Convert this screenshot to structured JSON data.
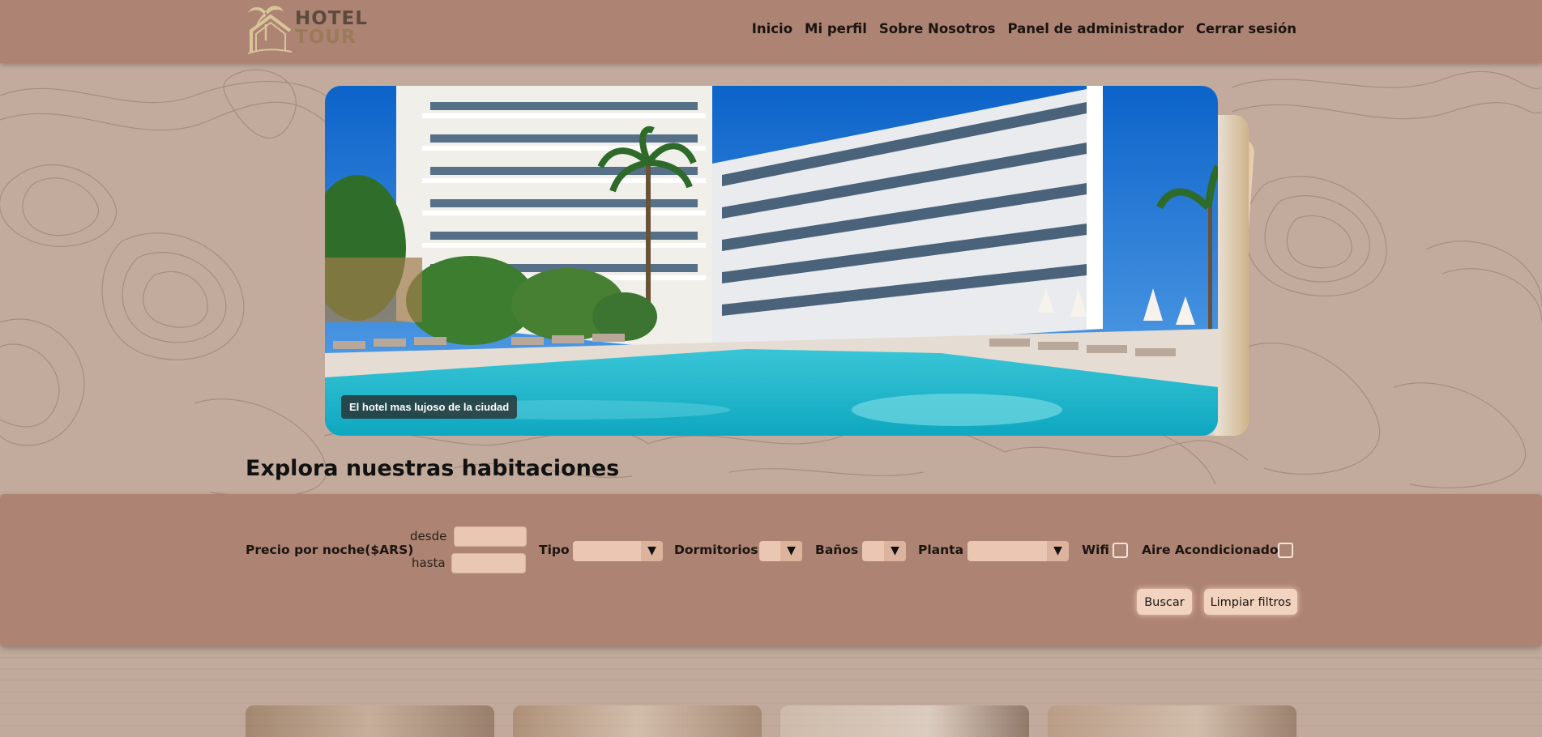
{
  "brand": {
    "logo_line1": "HOTEL",
    "logo_line2": "TOUR"
  },
  "nav": {
    "items": [
      {
        "label": "Inicio"
      },
      {
        "label": "Mi perfil"
      },
      {
        "label": "Sobre Nosotros"
      },
      {
        "label": "Panel de administrador"
      },
      {
        "label": "Cerrar sesión"
      }
    ]
  },
  "carousel": {
    "caption": "El hotel mas lujoso de la ciudad"
  },
  "section": {
    "title": "Explora nuestras habitaciones"
  },
  "filters": {
    "price_label": "Precio por noche($ARS)",
    "from_label": "desde",
    "to_label": "hasta",
    "from_value": "",
    "to_value": "",
    "type_label": "Tipo",
    "type_value": "",
    "bedrooms_label": "Dormitorios",
    "bedrooms_value": "",
    "bathrooms_label": "Baños",
    "bathrooms_value": "",
    "floor_label": "Planta",
    "floor_value": "",
    "wifi_label": "Wifi",
    "ac_label": "Aire Acondicionado",
    "search_button": "Buscar",
    "clear_button": "Limpiar filtros"
  },
  "colors": {
    "header": "#ad8373",
    "input": "#e9c7b2",
    "button": "#f2d3c0"
  }
}
